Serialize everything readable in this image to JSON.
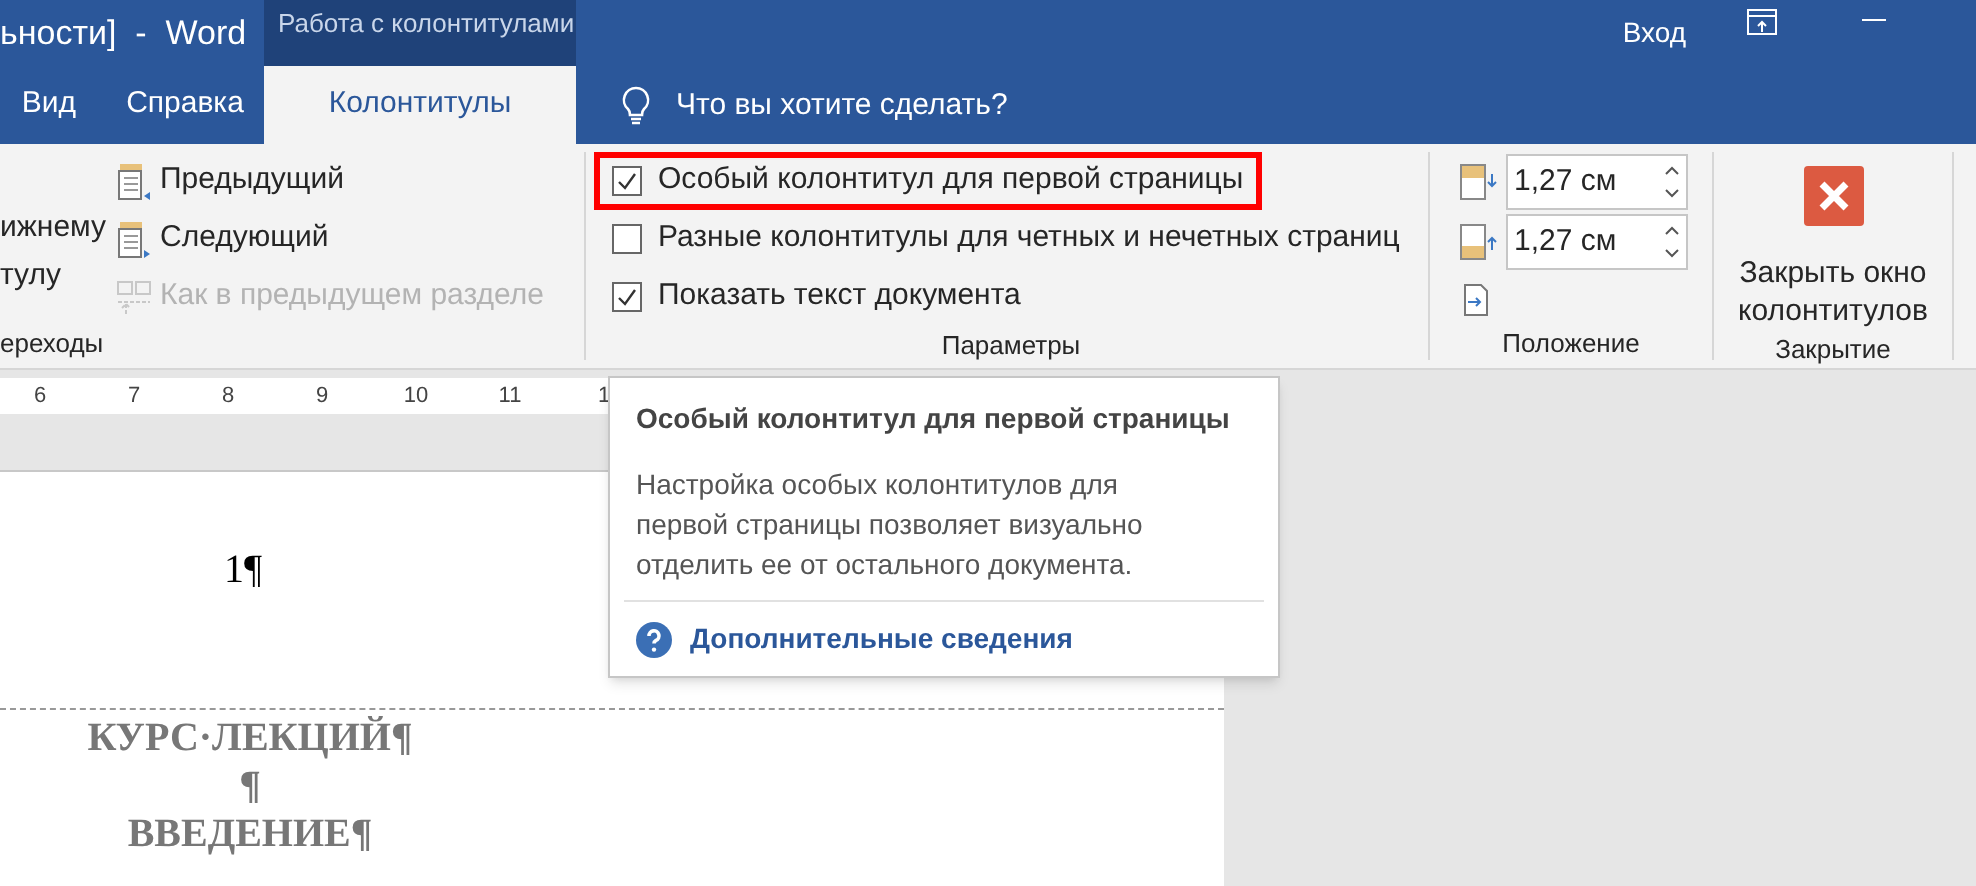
{
  "window": {
    "title": "ьности]  -  Word",
    "context_title": "Работа с колонтитулами",
    "sign_in": "Вход"
  },
  "tabs": [
    {
      "label": "Вид",
      "selected": false
    },
    {
      "label": "Справка",
      "selected": false
    },
    {
      "label": "Колонтитулы",
      "selected": true
    }
  ],
  "tell_me": {
    "placeholder": "Что вы хотите сделать?"
  },
  "ribbon": {
    "navigation": {
      "label": "ереходы",
      "partial_button": [
        "ижнему",
        "тулу"
      ],
      "items": [
        {
          "label": "Предыдущий",
          "disabled": false,
          "kind": "previous"
        },
        {
          "label": "Следующий",
          "disabled": false,
          "kind": "next"
        },
        {
          "label": "Как в предыдущем разделе",
          "disabled": true,
          "kind": "link"
        }
      ]
    },
    "options": {
      "label": "Параметры",
      "items": [
        {
          "label": "Особый колонтитул для первой страницы",
          "checked": true,
          "highlighted": true
        },
        {
          "label": "Разные колонтитулы для четных и нечетных страниц",
          "checked": false,
          "highlighted": false
        },
        {
          "label": "Показать текст документа",
          "checked": true,
          "highlighted": false
        }
      ]
    },
    "position": {
      "label": "Положение",
      "fields": [
        {
          "value": "1,27 см",
          "kind": "header"
        },
        {
          "value": "1,27 см",
          "kind": "footer"
        }
      ]
    },
    "close": {
      "label": "Закрытие",
      "button": "Закрыть окно колонтитулов"
    }
  },
  "ruler": {
    "numbers": [
      "6",
      "7",
      "8",
      "9",
      "10",
      "11",
      "1"
    ]
  },
  "document": {
    "header": "1¶",
    "lines": [
      "КУРС·ЛЕКЦИЙ¶",
      "¶",
      "ВВЕДЕНИЕ¶"
    ]
  },
  "tooltip": {
    "title": "Особый колонтитул для первой страницы",
    "body": "Настройка особых колонтитулов для первой страницы позволяет визуально отделить ее от остального документа.",
    "link": "Дополнительные сведения"
  }
}
